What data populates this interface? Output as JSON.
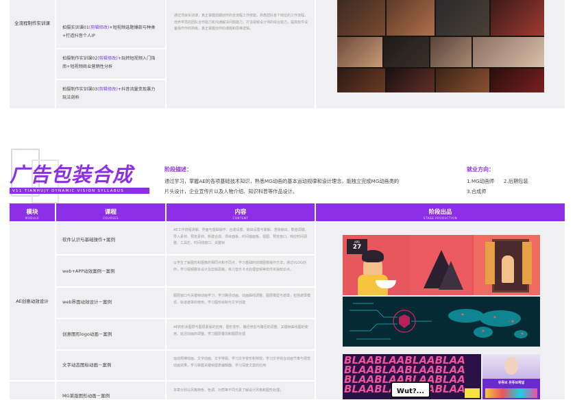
{
  "top_table": {
    "module_label": "全流程制作实训课",
    "courses": [
      {
        "pre": "拍摄实训课01",
        "hl": "(剪辑修改)",
        "post": "+短视频选题爆款与种类+打造抖音个人IP"
      },
      {
        "pre": "拍摄制作实训课02",
        "hl": "(剪辑修改)",
        "post": "+玩转短视频入门指南+短视频商业营销性分析"
      },
      {
        "pre": "拍摄制作实训课03",
        "hl": "(剪辑修改)",
        "post": "+抖音流量变现暴力玩法剖析"
      }
    ],
    "content": "通过项目实训课，真正掌握前期创作的全流程工作技能，熟悉团队各个岗位的工作流程，培养学员的团队合作能力和沟通解决问题能力，打造视频设计师的综合能力，提高软件设备操作作的熟练，真正掌握创作的课题和思维逻辑。"
  },
  "section": {
    "title": "广告包装合成",
    "subtitle": "V11 TIANHUJY  DYNAMIC VISION SYLLABUS",
    "stage_label": "阶段描述：",
    "stage_desc_line1": "通过学习，掌握AE的各项基础技术知识，熟悉MG动画的基本运动规律和设计理念，能独立完成MG动画类的",
    "stage_desc_line2": "片头设计，企业宣传片以及人物介绍、知识科普等作品设计。",
    "career_label": "就业方向：",
    "career_line1": "1.MG动画师      2.后期包装",
    "career_line2": "3.合成师"
  },
  "table_headers": {
    "module": {
      "title": "模块",
      "sub": "MODULE"
    },
    "course": {
      "title": "课程",
      "sub": "COURSES"
    },
    "content": {
      "title": "内容",
      "sub": "CONTENT"
    },
    "output": {
      "title": "阶段出品",
      "sub": "STAGE PRODUCTION"
    }
  },
  "ae_table": {
    "module_label": "AE创意动效设计",
    "rows": [
      {
        "course": "软件认识与基础操作+案例",
        "content": "AE工作流程讲解、界面与基础操作、合成设置、输出设置与破解、渲染输出、数值调键。导入素材、预览素材、新建合成、项目面板、时间轴面板、视图、预览窗口、响应时间调整、工具栏、时间线窗口、关键帧"
      },
      {
        "course": "web+APP动效案例－案例",
        "content": "以学生了解图形和图像的相同点和不同点，学习基础的前端图像操作方法；通过VLOG创作，学习视频脚本设计及剪辑思路，练习音乐卡点处理音频等软件实操知识点。"
      },
      {
        "course": "web界面动效设计－案例",
        "content": "图层窗口与关键帧动画学习，学习路径动画、动画曲线调整、图层模型与遮罩，包括遮罩模式、轨道遮罩的使用，学习图形绘制与文字创建"
      },
      {
        "course": "创意图形logo动画－案例",
        "content": "AE的形状图层与图层蒙版的应用、图形变形、路径修剪与路径的调整、关键帧曲线图的使用、延迟动画的调整、学习图层叠加和图层处理"
      },
      {
        "course": "文字动态图标动画－案例",
        "content": "运动规律动画、文字动画、文字排版、学习文字变形和特效，学习文字综合动画节奏与视觉动画效果，学习掌握关键帧图表编辑器、学习深度文案的应用"
      },
      {
        "course": "MG某版图形动画－案例",
        "content": "本章分别以风格特色、色调、对质等不同元素了解设计风格和图形处理；"
      }
    ]
  },
  "stills": {
    "poster_date_label": "APR",
    "poster_date_num": "27",
    "blah_text": "BLAABLAABLAABLAA",
    "speech_text": "Wut?...",
    "kr_text": "유튜브 유튜브채널"
  },
  "colors": {
    "accent": "#8d2fe6",
    "grid_grey": "#f0f0f2",
    "poster_bg": "#e9535a",
    "neon_bg": "#062a34",
    "blah_bg": "#2a1246",
    "blah_pink": "#f0529b"
  }
}
